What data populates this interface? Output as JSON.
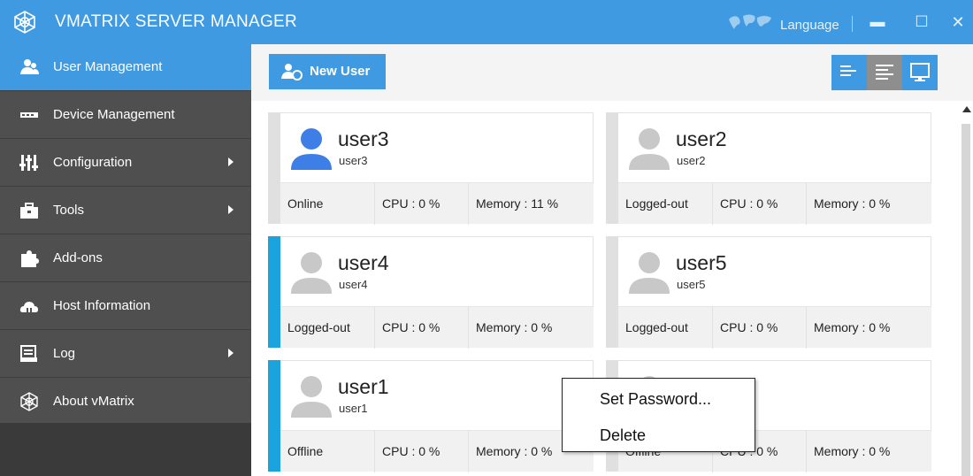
{
  "app": {
    "title": "VMATRIX SERVER MANAGER",
    "language_label": "Language",
    "minimize_glyph": "▬",
    "maximize_glyph": "☐",
    "close_glyph": "✕"
  },
  "colors": {
    "accent": "#3f9ae1",
    "sidebar_bg": "#4f4f4f",
    "selected_stripe": "#1aa3dc",
    "avatar_online": "#3d7fe6",
    "avatar_offline": "#c8c8c8"
  },
  "sidebar": {
    "items": [
      {
        "label": "User Management",
        "icon": "users-icon",
        "active": true,
        "has_submenu": false
      },
      {
        "label": "Device Management",
        "icon": "device-icon",
        "active": false,
        "has_submenu": false
      },
      {
        "label": "Configuration",
        "icon": "sliders-icon",
        "active": false,
        "has_submenu": true
      },
      {
        "label": "Tools",
        "icon": "toolbox-icon",
        "active": false,
        "has_submenu": true
      },
      {
        "label": "Add-ons",
        "icon": "puzzle-icon",
        "active": false,
        "has_submenu": false
      },
      {
        "label": "Host Information",
        "icon": "cloud-icon",
        "active": false,
        "has_submenu": false
      },
      {
        "label": "Log",
        "icon": "log-icon",
        "active": false,
        "has_submenu": true
      },
      {
        "label": "About vMatrix",
        "icon": "vmatrix-logo-icon",
        "active": false,
        "has_submenu": false
      }
    ]
  },
  "toolbar": {
    "new_user_label": "New User",
    "view_buttons": [
      "list-view-icon",
      "detail-view-icon",
      "monitor-view-icon"
    ],
    "active_view": "detail-view-icon"
  },
  "users": [
    {
      "name": "user3",
      "sub": "user3",
      "status": "Online",
      "cpu": "CPU : 0 %",
      "memory": "Memory : 11 %",
      "selected": false
    },
    {
      "name": "user2",
      "sub": "user2",
      "status": "Logged-out",
      "cpu": "CPU : 0 %",
      "memory": "Memory : 0 %",
      "selected": false
    },
    {
      "name": "user4",
      "sub": "user4",
      "status": "Logged-out",
      "cpu": "CPU : 0 %",
      "memory": "Memory : 0 %",
      "selected": true
    },
    {
      "name": "user5",
      "sub": "user5",
      "status": "Logged-out",
      "cpu": "CPU : 0 %",
      "memory": "Memory : 0 %",
      "selected": false
    },
    {
      "name": "user1",
      "sub": "user1",
      "status": "Offline",
      "cpu": "CPU : 0 %",
      "memory": "Memory : 0 %",
      "selected": true
    },
    {
      "name": "",
      "sub": "",
      "status": "Offline",
      "cpu": "CPU : 0 %",
      "memory": "Memory : 0 %",
      "selected": false
    }
  ],
  "context_menu": {
    "items": [
      "Set Password...",
      "Delete"
    ]
  }
}
